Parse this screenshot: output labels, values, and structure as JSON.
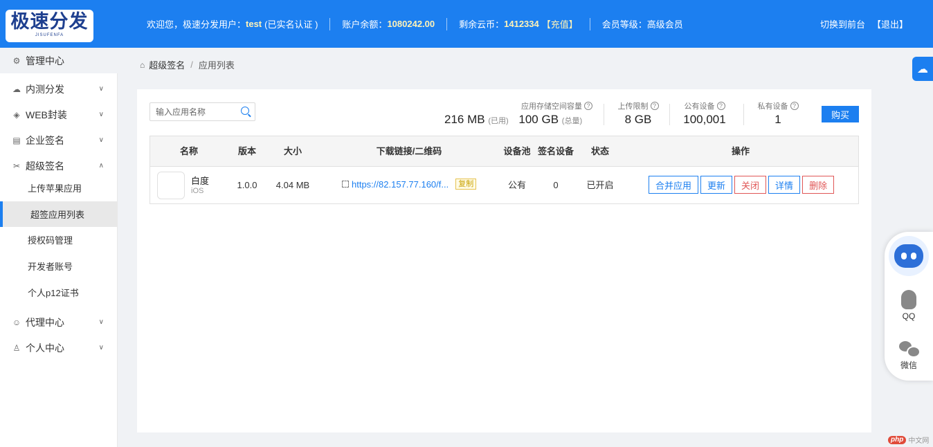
{
  "header": {
    "logo_main": "极速分发",
    "logo_sub": "JISUFENFA",
    "welcome_prefix": "欢迎您，极速分发用户：",
    "username": "test",
    "verify_status": "(已实名认证 )",
    "balance_label": "账户余额：",
    "balance_value": "1080242.00",
    "coins_label": "剩余云币：",
    "coins_value": "1412334",
    "recharge": "【充值】",
    "level_label": "会员等级：",
    "level_value": "高级会员",
    "switch_front": "切换到前台",
    "logout": "【退出】"
  },
  "sidebar": {
    "admin_center": "管理中心",
    "items": [
      {
        "label": "内测分发"
      },
      {
        "label": "WEB封装"
      },
      {
        "label": "企业签名"
      },
      {
        "label": "超级签名"
      }
    ],
    "sub_items": [
      {
        "label": "上传苹果应用"
      },
      {
        "label": "超签应用列表"
      },
      {
        "label": "授权码管理"
      },
      {
        "label": "开发者账号"
      },
      {
        "label": "个人p12证书"
      }
    ],
    "bottom_items": [
      {
        "label": "代理中心"
      },
      {
        "label": "个人中心"
      }
    ]
  },
  "breadcrumb": {
    "parent": "超级签名",
    "separator": "/",
    "current": "应用列表"
  },
  "search": {
    "placeholder": "输入应用名称"
  },
  "stats": {
    "storage_label": "应用存储空间容量",
    "used_value": "216 MB",
    "used_tag": "(已用)",
    "total_value": "100 GB",
    "total_tag": "(总量)",
    "upload_label": "上传限制",
    "upload_value": "8 GB",
    "public_label": "公有设备",
    "public_value": "100,001",
    "private_label": "私有设备",
    "private_value": "1",
    "buy": "购买"
  },
  "table": {
    "headers": [
      "名称",
      "版本",
      "大小",
      "下载链接/二维码",
      "设备池",
      "签名设备",
      "状态",
      "操作"
    ],
    "rows": [
      {
        "name": "白度",
        "os": "iOS",
        "version": "1.0.0",
        "size": "4.04 MB",
        "link": "https://82.157.77.160/f...",
        "copy": "复制",
        "pool": "公有",
        "devices": "0",
        "status": "已开启",
        "actions": [
          "合并应用",
          "更新",
          "关闭",
          "详情",
          "删除"
        ]
      }
    ]
  },
  "float": {
    "qq": "QQ",
    "wechat": "微信"
  },
  "watermark": {
    "brand": "php",
    "site": "中文网"
  },
  "colors": {
    "primary": "#1c7ff0",
    "danger": "#e05656",
    "highlight": "#fff3b8"
  }
}
